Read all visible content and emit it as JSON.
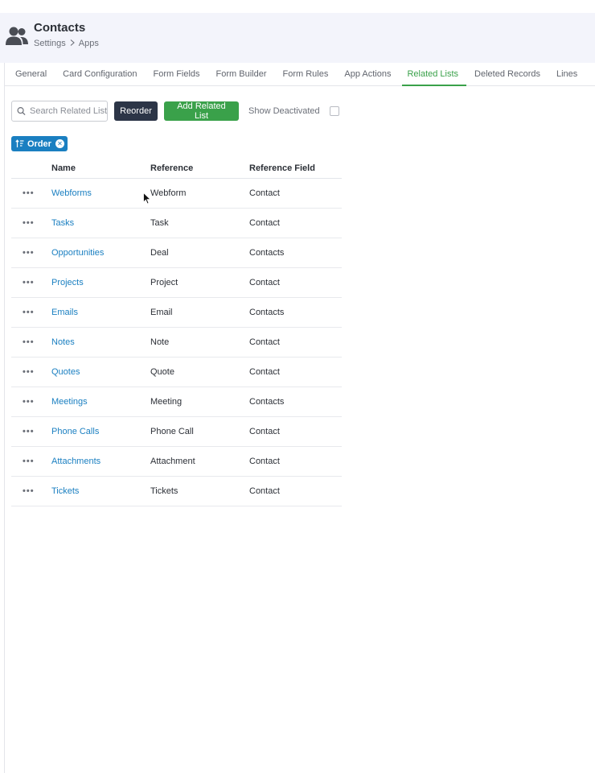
{
  "header": {
    "title": "Contacts",
    "breadcrumb": [
      "Settings",
      "Apps"
    ]
  },
  "tabs": [
    {
      "label": "General",
      "active": false
    },
    {
      "label": "Card Configuration",
      "active": false
    },
    {
      "label": "Form Fields",
      "active": false
    },
    {
      "label": "Form Builder",
      "active": false
    },
    {
      "label": "Form Rules",
      "active": false
    },
    {
      "label": "App Actions",
      "active": false
    },
    {
      "label": "Related Lists",
      "active": true
    },
    {
      "label": "Deleted Records",
      "active": false
    },
    {
      "label": "Lines",
      "active": false
    }
  ],
  "toolbar": {
    "search_placeholder": "Search Related List",
    "reorder_label": "Reorder",
    "add_label": "Add Related List",
    "show_deactivated_label": "Show Deactivated",
    "show_deactivated_checked": false
  },
  "filter": {
    "label": "Order"
  },
  "table": {
    "columns": [
      "Name",
      "Reference",
      "Reference Field"
    ],
    "menu_glyph": "•••",
    "rows": [
      {
        "name": "Webforms",
        "reference": "Webform",
        "field": "Contact"
      },
      {
        "name": "Tasks",
        "reference": "Task",
        "field": "Contact"
      },
      {
        "name": "Opportunities",
        "reference": "Deal",
        "field": "Contacts"
      },
      {
        "name": "Projects",
        "reference": "Project",
        "field": "Contact"
      },
      {
        "name": "Emails",
        "reference": "Email",
        "field": "Contacts"
      },
      {
        "name": "Notes",
        "reference": "Note",
        "field": "Contact"
      },
      {
        "name": "Quotes",
        "reference": "Quote",
        "field": "Contact"
      },
      {
        "name": "Meetings",
        "reference": "Meeting",
        "field": "Contacts"
      },
      {
        "name": "Phone Calls",
        "reference": "Phone Call",
        "field": "Contact"
      },
      {
        "name": "Attachments",
        "reference": "Attachment",
        "field": "Contact"
      },
      {
        "name": "Tickets",
        "reference": "Tickets",
        "field": "Contact"
      }
    ]
  },
  "colors": {
    "accent_green": "#3aa14a",
    "link_blue": "#1a7fc1",
    "dark_button": "#2c3547",
    "header_bg": "#f3f4fb"
  }
}
